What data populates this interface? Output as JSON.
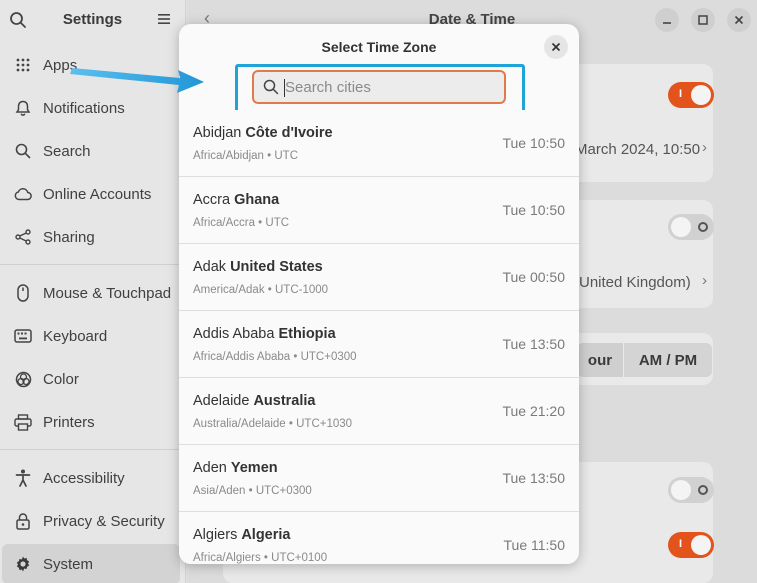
{
  "sidebar": {
    "title": "Settings",
    "items": [
      {
        "label": "Apps",
        "icon": "apps-grid-icon"
      },
      {
        "label": "Notifications",
        "icon": "bell-icon"
      },
      {
        "label": "Search",
        "icon": "search-icon"
      },
      {
        "label": "Online Accounts",
        "icon": "cloud-icon"
      },
      {
        "label": "Sharing",
        "icon": "share-icon"
      },
      {
        "label": "Mouse & Touchpad",
        "icon": "mouse-icon"
      },
      {
        "label": "Keyboard",
        "icon": "keyboard-icon"
      },
      {
        "label": "Color",
        "icon": "color-icon"
      },
      {
        "label": "Printers",
        "icon": "printer-icon"
      },
      {
        "label": "Accessibility",
        "icon": "accessibility-icon"
      },
      {
        "label": "Privacy & Security",
        "icon": "lock-icon"
      },
      {
        "label": "System",
        "icon": "gear-icon"
      }
    ]
  },
  "main": {
    "title": "Date & Time",
    "date_time_value": "March 2024, 10:50",
    "timezone_value": "United Kingdom)",
    "format_option_left": "our",
    "format_option_right": "AM / PM"
  },
  "dialog": {
    "title": "Select Time Zone",
    "search_placeholder": "Search cities",
    "timezones": [
      {
        "city": "Abidjan",
        "country": "Côte d'Ivoire",
        "zone": "Africa/Abidjan • UTC",
        "time": "Tue 10:50"
      },
      {
        "city": "Accra",
        "country": "Ghana",
        "zone": "Africa/Accra • UTC",
        "time": "Tue 10:50"
      },
      {
        "city": "Adak",
        "country": "United States",
        "zone": "America/Adak • UTC-1000",
        "time": "Tue 00:50"
      },
      {
        "city": "Addis Ababa",
        "country": "Ethiopia",
        "zone": "Africa/Addis Ababa • UTC+0300",
        "time": "Tue 13:50"
      },
      {
        "city": "Adelaide",
        "country": "Australia",
        "zone": "Australia/Adelaide • UTC+1030",
        "time": "Tue 21:20"
      },
      {
        "city": "Aden",
        "country": "Yemen",
        "zone": "Asia/Aden • UTC+0300",
        "time": "Tue 13:50"
      },
      {
        "city": "Algiers",
        "country": "Algeria",
        "zone": "Africa/Algiers • UTC+0100",
        "time": "Tue 11:50"
      }
    ]
  },
  "colors": {
    "accent": "#e2541c",
    "highlight": "#1ea4d9",
    "arrow": "#2aa6e0"
  }
}
